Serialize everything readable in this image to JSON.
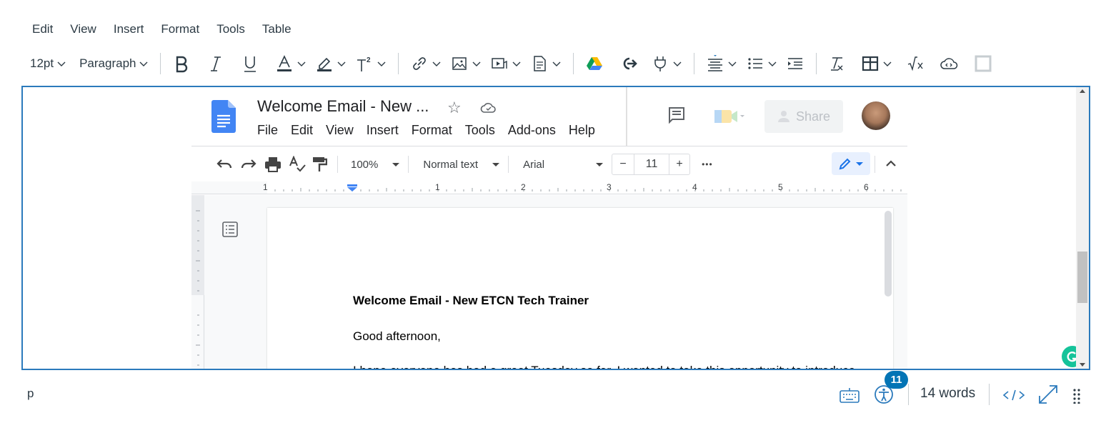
{
  "menubar": {
    "items": [
      "Edit",
      "View",
      "Insert",
      "Format",
      "Tools",
      "Table"
    ]
  },
  "toolbar": {
    "font_size": "12pt",
    "block_format": "Paragraph",
    "icons": [
      "bold-icon",
      "italic-icon",
      "underline-icon",
      "text-color-icon",
      "highlight-icon",
      "superscript-icon",
      "link-icon",
      "image-icon",
      "media-icon",
      "document-icon",
      "google-drive-icon",
      "external-tool-icon",
      "plug-icon",
      "align-icon",
      "bullet-list-icon",
      "indent-icon",
      "clear-format-icon",
      "table-icon",
      "equation-icon",
      "cloud-embed-icon",
      "border-icon"
    ],
    "accent": "#2d3b45"
  },
  "gdoc": {
    "title": "Welcome Email - New ...",
    "menu": [
      "File",
      "Edit",
      "View",
      "Insert",
      "Format",
      "Tools",
      "Add-ons",
      "Help"
    ],
    "share_label": "Share",
    "zoom": "100%",
    "style": "Normal text",
    "font": "Arial",
    "font_size": "11",
    "minus": "−",
    "plus": "+",
    "more": "•••",
    "ruler_numbers": [
      "1",
      "1",
      "2",
      "3",
      "4",
      "5",
      "6"
    ],
    "heading": "Welcome Email - New ETCN Tech Trainer",
    "greeting": "Good afternoon,",
    "body_partial": "I hope everyone has had a great Tuesday so far. I wanted to take this opportunity to introduce"
  },
  "status": {
    "path": "p",
    "a11y_count": "11",
    "words": "14 words",
    "badge_color": "#0374b5"
  }
}
